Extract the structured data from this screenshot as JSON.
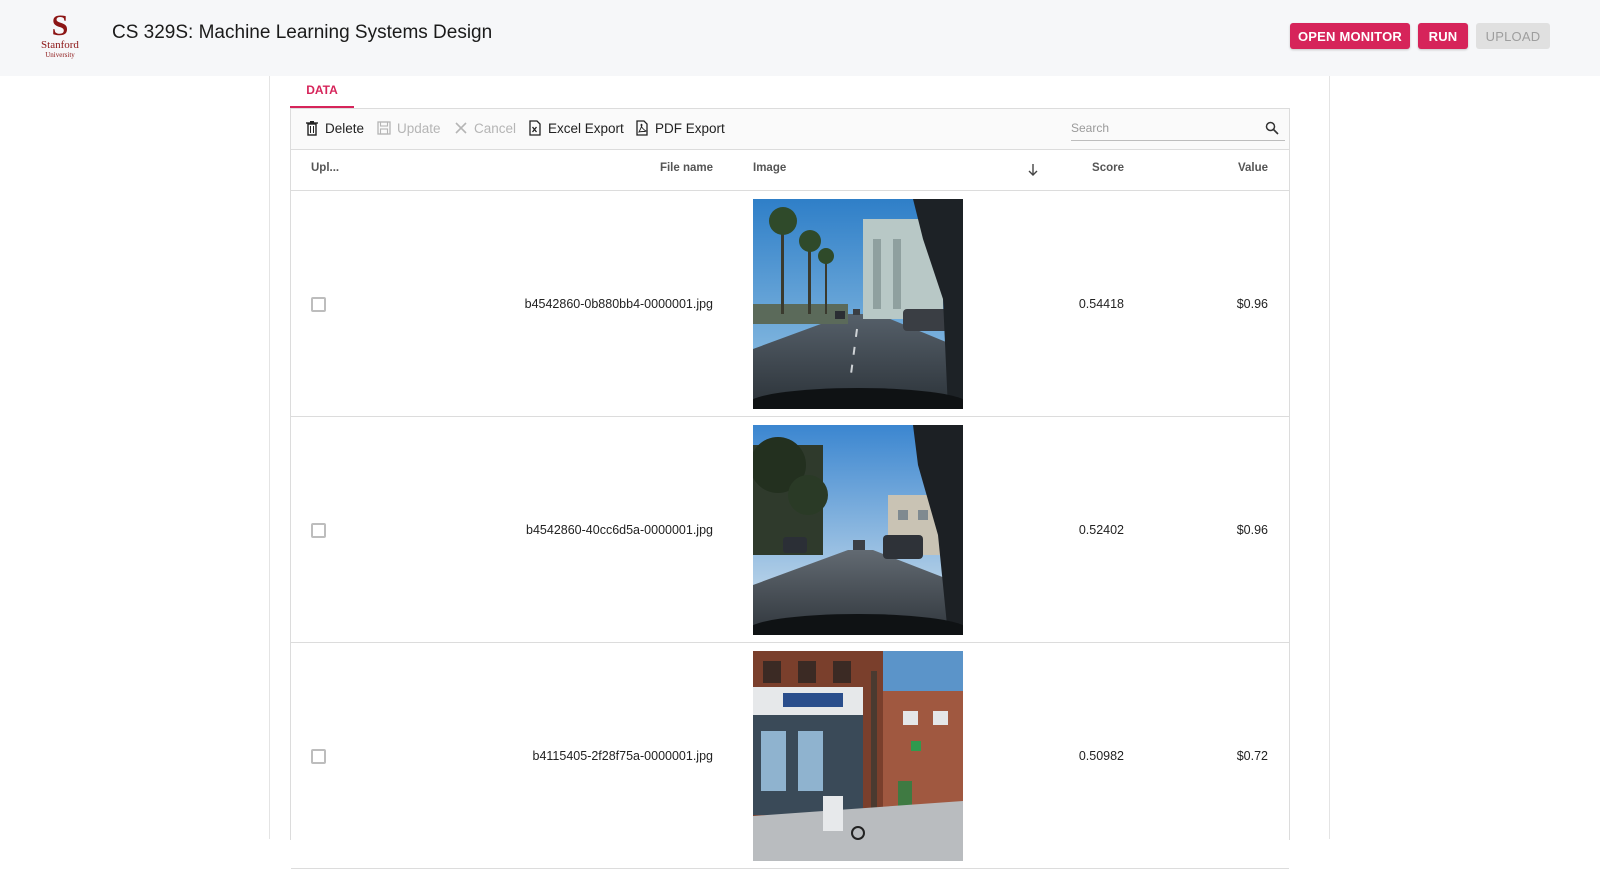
{
  "header": {
    "logo": {
      "mark": "S",
      "name": "Stanford",
      "sub": "University"
    },
    "title": "CS 329S: Machine Learning Systems Design",
    "buttons": {
      "open_monitor": "OPEN MONITOR",
      "run": "RUN",
      "upload": "UPLOAD"
    }
  },
  "tabs": [
    {
      "label": "DATA",
      "active": true
    }
  ],
  "toolbar": {
    "delete": "Delete",
    "update": "Update",
    "cancel": "Cancel",
    "excel_export": "Excel Export",
    "pdf_export": "PDF Export",
    "search_placeholder": "Search"
  },
  "columns": {
    "uploaded": "Upl...",
    "file_name": "File name",
    "image": "Image",
    "score": "Score",
    "value": "Value"
  },
  "rows": [
    {
      "file_name": "b4542860-0b880bb4-0000001.jpg",
      "score": "0.54418",
      "value": "$0.96",
      "checked": false
    },
    {
      "file_name": "b4542860-40cc6d5a-0000001.jpg",
      "score": "0.52402",
      "value": "$0.96",
      "checked": false
    },
    {
      "file_name": "b4115405-2f28f75a-0000001.jpg",
      "score": "0.50982",
      "value": "$0.72",
      "checked": false
    }
  ],
  "colors": {
    "accent": "#d6245a",
    "brand": "#8c1515",
    "header_bg": "#f6f7f9"
  },
  "icons": [
    "trash-icon",
    "save-icon",
    "close-icon",
    "excel-file-icon",
    "pdf-file-icon",
    "search-icon",
    "arrow-down-icon"
  ]
}
